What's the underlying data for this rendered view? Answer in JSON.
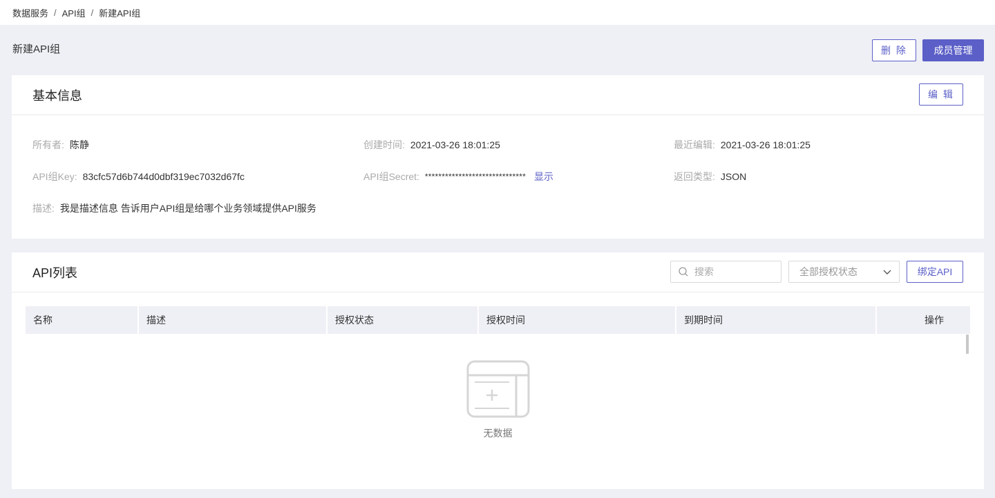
{
  "breadcrumb": [
    "数据服务",
    "API组",
    "新建API组"
  ],
  "breadcrumb_sep": "/",
  "page": {
    "title": "新建API组",
    "delete_label": "删 除",
    "members_label": "成员管理"
  },
  "basic_info": {
    "title": "基本信息",
    "edit_label": "编 辑",
    "owner_label": "所有者:",
    "owner": "陈静",
    "created_label": "创建时间:",
    "created": "2021-03-26 18:01:25",
    "edited_label": "最近编辑:",
    "edited": "2021-03-26 18:01:25",
    "key_label": "API组Key:",
    "key": "83cfc57d6b744d0dbf319ec7032d67fc",
    "secret_label": "API组Secret:",
    "secret": "******************************",
    "show_label": "显示",
    "return_label": "返回类型:",
    "return_type": "JSON",
    "desc_label": "描述:",
    "desc": "我是描述信息 告诉用户API组是给哪个业务领域提供API服务"
  },
  "api_list": {
    "title": "API列表",
    "search_placeholder": "搜索",
    "filter_value": "全部授权状态",
    "bind_label": "绑定API",
    "columns": [
      "名称",
      "描述",
      "授权状态",
      "授权时间",
      "到期时间",
      "操作"
    ],
    "rows": [],
    "empty_text": "无数据"
  },
  "colors": {
    "accent": "#5b5fc7",
    "background": "#eef0f5"
  }
}
